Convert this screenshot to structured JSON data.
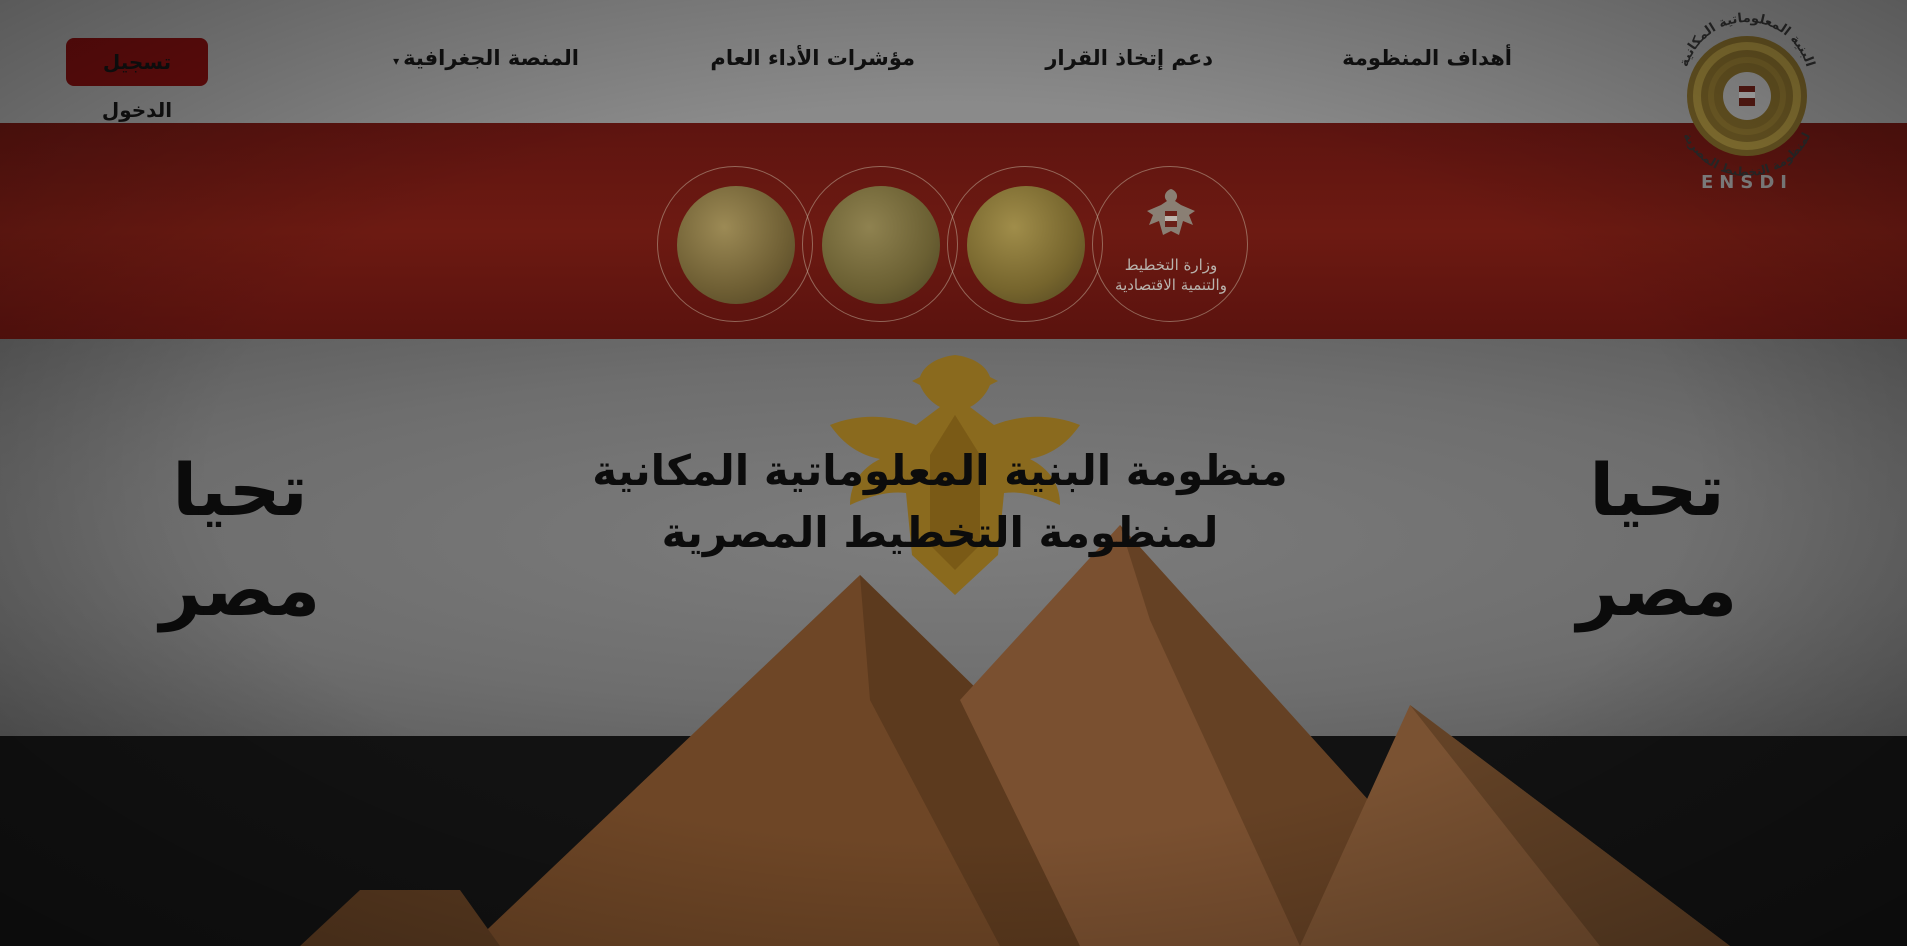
{
  "header": {
    "logo_top_text": "البنية المعلوماتية المكانية",
    "logo_bottom_text": "لمنظومة التخطيط المصرية",
    "logo_abbrev": "ENSDI",
    "nav": [
      {
        "label": "أهداف المنظومة"
      },
      {
        "label": "دعم إتخاذ القرار"
      },
      {
        "label": "مؤشرات الأداء العام"
      },
      {
        "label": "المنصة الجغرافية",
        "has_dropdown": true
      }
    ],
    "login_label": "تسجيل الدخول"
  },
  "hero": {
    "ministry_line1": "وزارة التخطيط",
    "ministry_line2": "والتنمية الاقتصادية",
    "slogan": "تحيا مصر",
    "title": "منظومة البنية المعلوماتية المكانية لمنظومة التخطيط المصرية"
  },
  "colors": {
    "flag_red": "#6d1a12",
    "flag_white": "#7d7d7d",
    "flag_black": "#121212",
    "login_bg": "#6a0d0d",
    "gold": "#9c8a55"
  }
}
